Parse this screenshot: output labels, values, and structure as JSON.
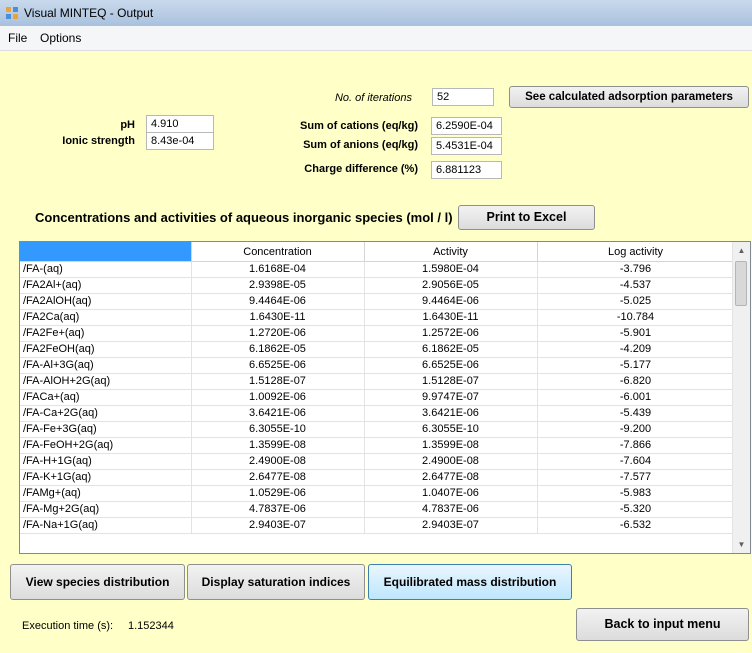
{
  "window": {
    "title": "Visual MINTEQ - Output"
  },
  "menu": [
    "File",
    "Options"
  ],
  "summary": {
    "iterations_label": "No. of iterations",
    "iterations_value": "52",
    "adsorption_button": "See calculated adsorption parameters",
    "ph_label": "pH",
    "ph_value": "4.910",
    "ionic_label": "Ionic strength",
    "ionic_value": "8.43e-04",
    "cations_label": "Sum of cations (eq/kg)",
    "cations_value": "6.2590E-04",
    "anions_label": "Sum of anions (eq/kg)",
    "anions_value": "5.4531E-04",
    "charge_label": "Charge difference (%)",
    "charge_value": "6.881123"
  },
  "section": {
    "heading": "Concentrations and activities of aqueous inorganic species (mol / l)",
    "print_button": "Print to Excel"
  },
  "table": {
    "columns": [
      "",
      "Concentration",
      "Activity",
      "Log activity"
    ],
    "rows": [
      [
        "/FA-(aq)",
        "1.6168E-04",
        "1.5980E-04",
        "-3.796"
      ],
      [
        "/FA2Al+(aq)",
        "2.9398E-05",
        "2.9056E-05",
        "-4.537"
      ],
      [
        "/FA2AlOH(aq)",
        "9.4464E-06",
        "9.4464E-06",
        "-5.025"
      ],
      [
        "/FA2Ca(aq)",
        "1.6430E-11",
        "1.6430E-11",
        "-10.784"
      ],
      [
        "/FA2Fe+(aq)",
        "1.2720E-06",
        "1.2572E-06",
        "-5.901"
      ],
      [
        "/FA2FeOH(aq)",
        "6.1862E-05",
        "6.1862E-05",
        "-4.209"
      ],
      [
        "/FA-Al+3G(aq)",
        "6.6525E-06",
        "6.6525E-06",
        "-5.177"
      ],
      [
        "/FA-AlOH+2G(aq)",
        "1.5128E-07",
        "1.5128E-07",
        "-6.820"
      ],
      [
        "/FACa+(aq)",
        "1.0092E-06",
        "9.9747E-07",
        "-6.001"
      ],
      [
        "/FA-Ca+2G(aq)",
        "3.6421E-06",
        "3.6421E-06",
        "-5.439"
      ],
      [
        "/FA-Fe+3G(aq)",
        "6.3055E-10",
        "6.3055E-10",
        "-9.200"
      ],
      [
        "/FA-FeOH+2G(aq)",
        "1.3599E-08",
        "1.3599E-08",
        "-7.866"
      ],
      [
        "/FA-H+1G(aq)",
        "2.4900E-08",
        "2.4900E-08",
        "-7.604"
      ],
      [
        "/FA-K+1G(aq)",
        "2.6477E-08",
        "2.6477E-08",
        "-7.577"
      ],
      [
        "/FAMg+(aq)",
        "1.0529E-06",
        "1.0407E-06",
        "-5.983"
      ],
      [
        "/FA-Mg+2G(aq)",
        "4.7837E-06",
        "4.7837E-06",
        "-5.320"
      ],
      [
        "/FA-Na+1G(aq)",
        "2.9403E-07",
        "2.9403E-07",
        "-6.532"
      ]
    ]
  },
  "buttons": {
    "species_distribution": "View species distribution",
    "saturation_indices": "Display saturation indices",
    "mass_distribution": "Equilibrated mass distribution",
    "back": "Back to input menu"
  },
  "status": {
    "execution_label": "Execution time (s):",
    "execution_value": "1.152344"
  }
}
